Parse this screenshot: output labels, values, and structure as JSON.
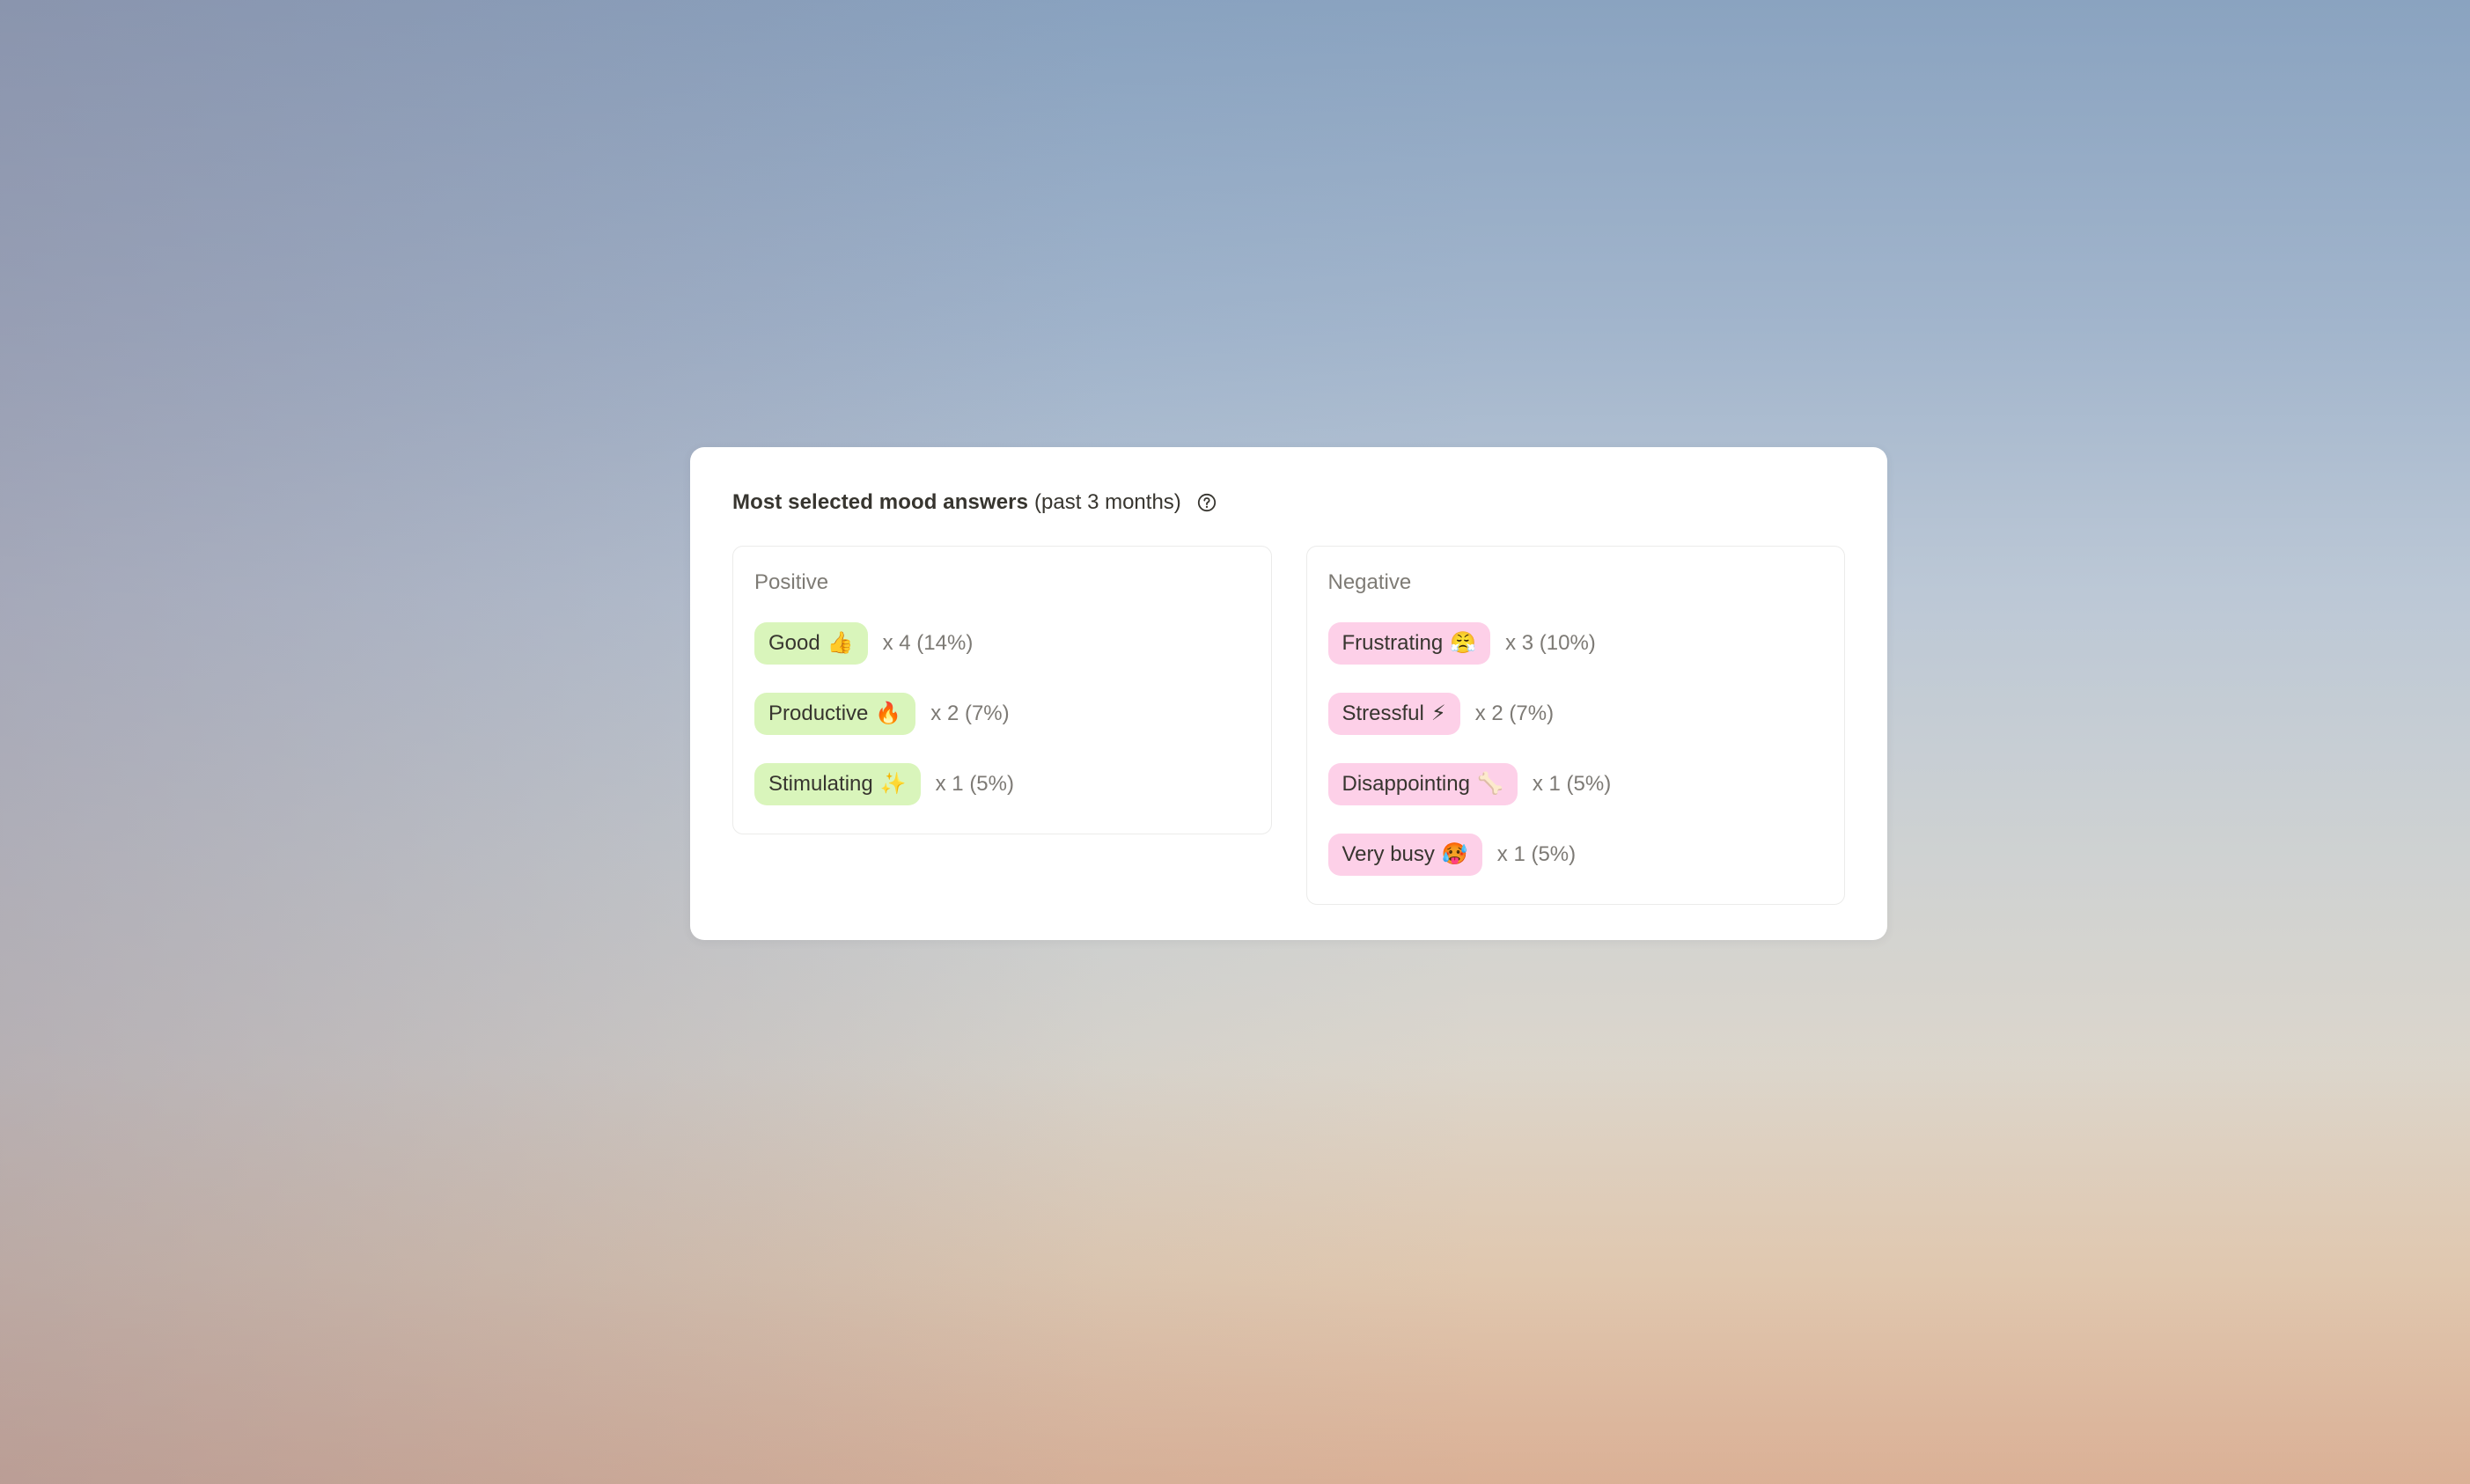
{
  "widget": {
    "title_bold": "Most selected mood answers",
    "title_sub": "(past 3 months)",
    "help_icon": "question-circle-icon"
  },
  "colors": {
    "positive_pill": "#d9f5bb",
    "negative_pill": "#fdd0e8",
    "text_primary": "#37352f",
    "text_muted": "#7d7a75"
  },
  "positive": {
    "label": "Positive",
    "items": [
      {
        "label": "Good",
        "emoji": "👍",
        "emoji_name": "thumbs-up-icon",
        "count": "x 4",
        "percent": "(14%)"
      },
      {
        "label": "Productive",
        "emoji": "🔥",
        "emoji_name": "fire-icon",
        "count": "x 2",
        "percent": "(7%)"
      },
      {
        "label": "Stimulating",
        "emoji": "✨",
        "emoji_name": "sparkles-icon",
        "count": "x 1",
        "percent": "(5%)"
      }
    ]
  },
  "negative": {
    "label": "Negative",
    "items": [
      {
        "label": "Frustrating",
        "emoji": "😤",
        "emoji_name": "steam-face-icon",
        "count": "x 3",
        "percent": "(10%)"
      },
      {
        "label": "Stressful",
        "emoji": "⚡",
        "emoji_name": "lightning-icon",
        "count": "x 2",
        "percent": "(7%)"
      },
      {
        "label": "Disappointing",
        "emoji": "🦴",
        "emoji_name": "bone-icon",
        "count": "x 1",
        "percent": "(5%)"
      },
      {
        "label": "Very busy",
        "emoji": "🥵",
        "emoji_name": "hot-face-icon",
        "count": "x 1",
        "percent": "(5%)"
      }
    ]
  }
}
